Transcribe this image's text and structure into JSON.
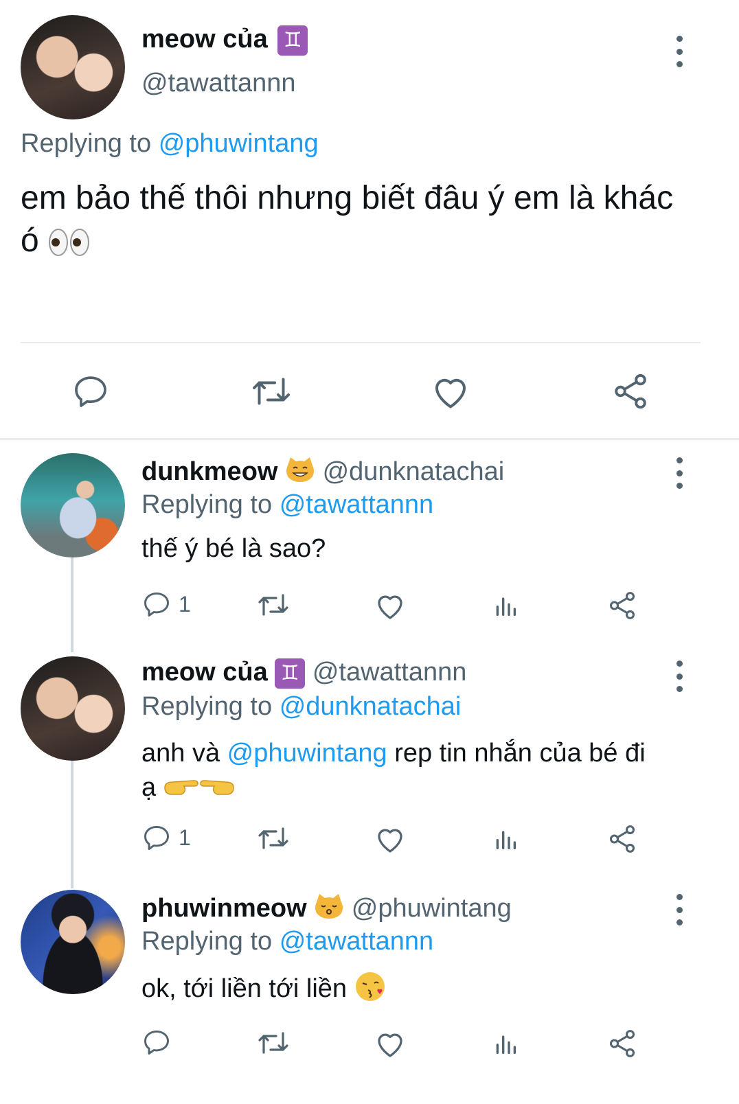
{
  "main_tweet": {
    "name": "meow của",
    "badge_icon": "gemini-sign-icon",
    "handle": "@tawattannn",
    "replying_prefix": "Replying to",
    "replying_to": "@phuwintang",
    "text": "em bảo thế thôi nhưng biết đâu ý em là khác ó",
    "emoji_icon": "eyes-emoji-icon"
  },
  "main_actions": [
    "reply-icon",
    "retweet-icon",
    "like-icon",
    "share-icon"
  ],
  "replies": [
    {
      "name": "dunkmeow",
      "badge_icon": "grinning-cat-emoji-icon",
      "handle": "@dunknatachai",
      "replying_prefix": "Replying to",
      "replying_to": "@tawattannn",
      "text": "thế ý bé là sao?",
      "reply_count": "1"
    },
    {
      "name": "meow của",
      "badge_icon": "gemini-sign-icon",
      "handle": "@tawattannn",
      "replying_prefix": "Replying to",
      "replying_to": "@dunknatachai",
      "text_before": "anh và",
      "mention": "@phuwintang",
      "text_after": "rep tin nhắn của bé đi",
      "text_line2": "ạ",
      "emoji_icon": "pointing-hands-emoji-icon",
      "reply_count": "1"
    },
    {
      "name": "phuwinmeow",
      "badge_icon": "kissing-cat-emoji-icon",
      "handle": "@phuwintang",
      "replying_prefix": "Replying to",
      "replying_to": "@tawattannn",
      "text": "ok, tới liền tới liền",
      "emoji_icon": "kissing-face-emoji-icon",
      "reply_count": ""
    }
  ],
  "colors": {
    "link": "#1d9bf0",
    "muted": "#536471",
    "divider": "#e6ecf0",
    "gemini": "#9b59b6"
  }
}
